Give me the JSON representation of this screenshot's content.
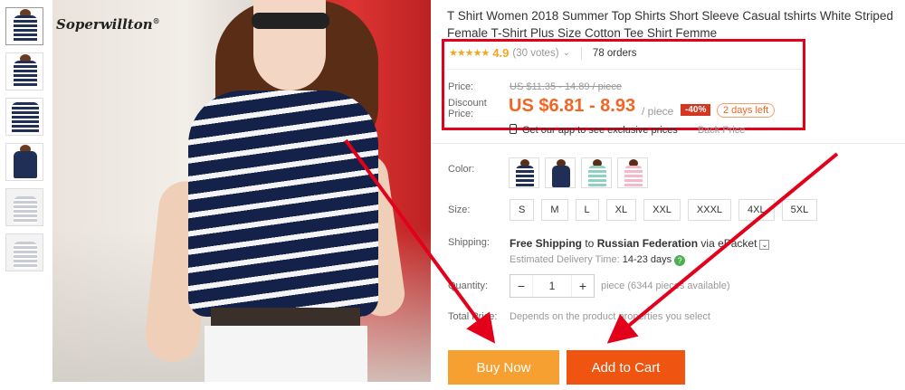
{
  "product": {
    "brand": "Soperwillton",
    "brand_mark": "®",
    "title": "T Shirt Women 2018 Summer Top Shirts Short Sleeve Casual tshirts White Striped Female T-Shirt Plus Size Cotton Tee Shirt Femme"
  },
  "rating": {
    "stars": "★★★★★",
    "score": "4.9",
    "votes": "(30 votes)",
    "orders": "78 orders"
  },
  "price": {
    "price_label": "Price:",
    "original": "US $11.35 - 14.89 / piece",
    "discount_label_1": "Discount",
    "discount_label_2": "Price:",
    "discount": "US $6.81 - 8.93",
    "unit": "/ piece",
    "discount_badge": "-40%",
    "time_left": "2 days left",
    "app_text": "Get our app to see exclusive prices",
    "app_back": "Back Price"
  },
  "options": {
    "color_label": "Color:",
    "colors": [
      "navy-stripe",
      "navy",
      "mint-stripe",
      "pink-stripe"
    ],
    "size_label": "Size:",
    "sizes": [
      "S",
      "M",
      "L",
      "XL",
      "XXL",
      "XXXL",
      "4XL",
      "5XL"
    ]
  },
  "shipping": {
    "label": "Shipping:",
    "text_pre": "Free Shipping",
    "text_mid": " to ",
    "text_country": "Russian Federation",
    "text_via": " via ePacket",
    "eta_label": "Estimated Delivery Time:",
    "eta_days": "14-23 days",
    "help_icon": "?"
  },
  "quantity": {
    "label": "Quantity:",
    "value": "1",
    "minus": "−",
    "plus": "+",
    "available": "piece (6344 pieces available)"
  },
  "total": {
    "label": "Total Price:",
    "text": "Depends on the product properties you select"
  },
  "actions": {
    "buy_now": "Buy Now",
    "add_to_cart": "Add to Cart"
  },
  "accent": {
    "highlight": "#e3001b",
    "price": "#f26522",
    "buy": "#f5a031",
    "cart": "#ef5410"
  }
}
